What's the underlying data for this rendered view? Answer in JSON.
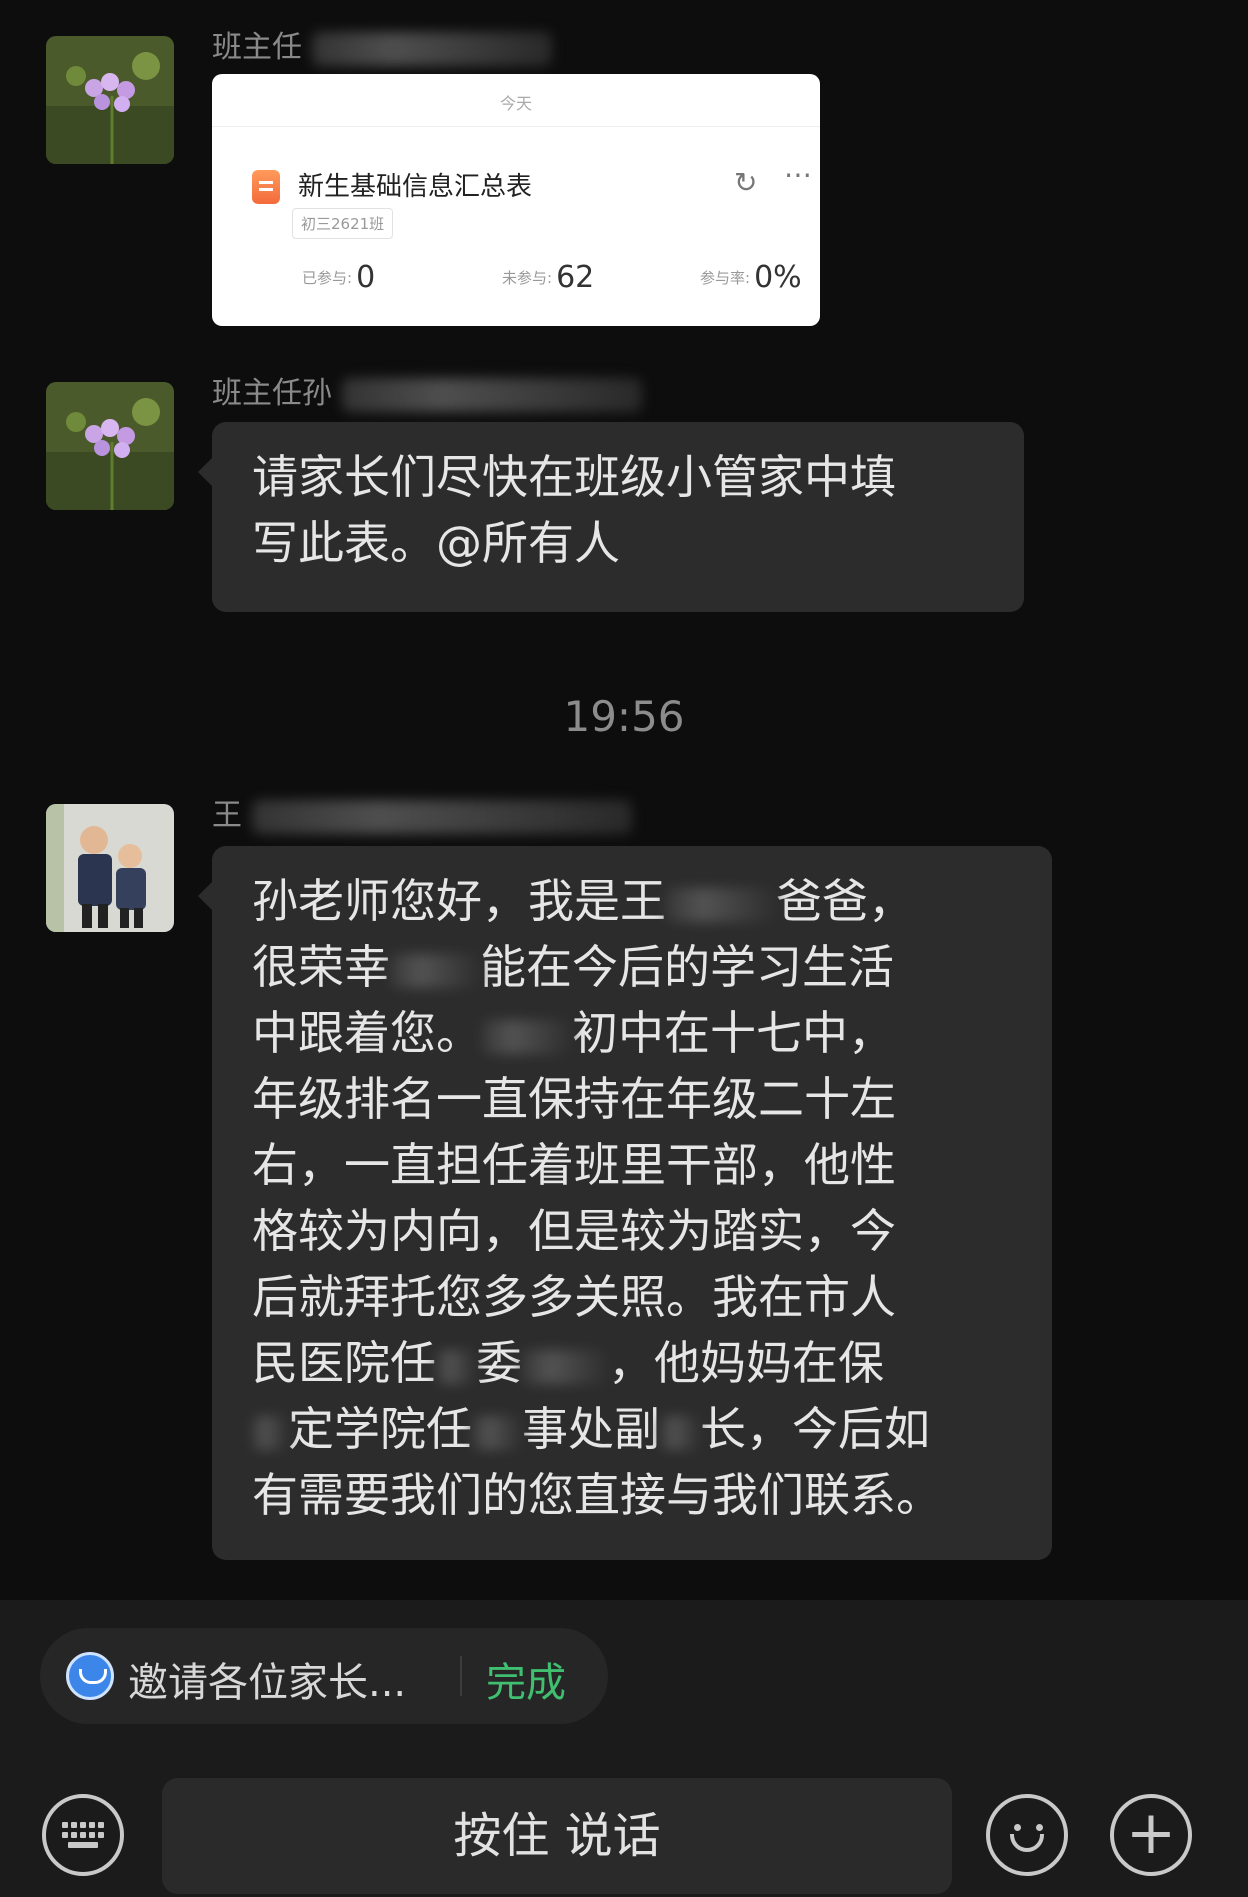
{
  "messages": [
    {
      "sender_visible": "班主任",
      "card": {
        "date_label": "今天",
        "title": "新生基础信息汇总表",
        "tag": "初三2621班",
        "stats": [
          {
            "label": "已参与:",
            "value": "0"
          },
          {
            "label": "未参与:",
            "value": "62"
          },
          {
            "label": "参与率:",
            "value": "0%"
          }
        ]
      }
    },
    {
      "sender_visible": "班主任孙",
      "text_lines": [
        "请家长们尽快在班级小管家中填",
        "写此表。@所有人"
      ]
    },
    {
      "timestamp": "19:56"
    },
    {
      "sender_visible": "王",
      "text_lines": [
        "孙老师您好，我是王",
        "很荣幸",
        "中跟着您。",
        "年级排名一直保持在年级二十左",
        "右，一直担任着班里干部，他性",
        "格较为内向，但是较为踏实，今",
        "后就拜托您多多关照。我在市人",
        "民医院任",
        "定学院任",
        "有需要我们的您直接与我们联系。"
      ],
      "text_fragments": {
        "l1_tail": "爸爸，",
        "l2_tail": "能在今后的学习生活",
        "l3_tail": "初中在十七中，",
        "l8_mid": "委",
        "l8_tail": "，他妈妈在保",
        "l9_mid": "事处副",
        "l9_tail": "长，今后如"
      }
    }
  ],
  "input_bar": {
    "suggestion_text": "邀请各位家长...",
    "suggestion_action": "完成",
    "voice_button_label": "按住 说话"
  },
  "icons": [
    "keyboard-icon",
    "emoji-icon",
    "plus-icon",
    "robot-icon",
    "share-icon",
    "more-icon"
  ],
  "colors": {
    "accent_green": "#3fbf6f",
    "bubble": "#2c2c2c",
    "background": "#0d0d0d"
  }
}
